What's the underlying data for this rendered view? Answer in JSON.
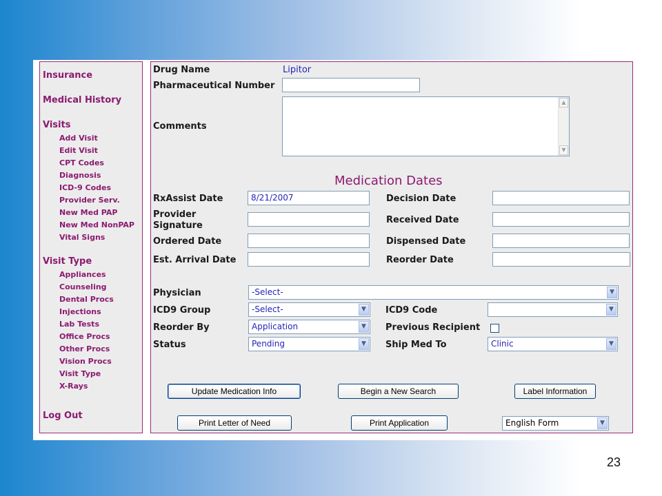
{
  "sidebar": {
    "insurance": "Insurance",
    "medical_history": "Medical History",
    "visits": "Visits",
    "visit_items": [
      "Add Visit",
      "Edit Visit",
      "CPT Codes",
      "Diagnosis",
      "ICD-9 Codes",
      "Provider Serv.",
      "New Med PAP",
      "New Med NonPAP",
      "Vital Signs"
    ],
    "visit_type": "Visit Type",
    "visit_type_items": [
      "Appliances",
      "Counseling",
      "Dental Procs",
      "Injections",
      "Lab Tests",
      "Office Procs",
      "Other Procs",
      "Vision Procs",
      "Visit Type",
      "X-Rays"
    ],
    "logout": "Log Out"
  },
  "form": {
    "drug_name_label": "Drug Name",
    "drug_name_value": "Lipitor",
    "pharma_number_label": "Pharmaceutical Number",
    "pharma_number_value": "",
    "comments_label": "Comments",
    "section_title": "Medication Dates",
    "rxassist_date_label": "RxAssist Date",
    "rxassist_date_value": "8/21/2007",
    "decision_date_label": "Decision Date",
    "provider_signature_label": "Provider Signature",
    "received_date_label": "Received Date",
    "ordered_date_label": "Ordered Date",
    "dispensed_date_label": "Dispensed Date",
    "est_arrival_label": "Est. Arrival Date",
    "reorder_date_label": "Reorder Date",
    "physician_label": "Physician",
    "physician_value": "-Select-",
    "icd9_group_label": "ICD9 Group",
    "icd9_group_value": "-Select-",
    "icd9_code_label": "ICD9 Code",
    "icd9_code_value": "",
    "reorder_by_label": "Reorder By",
    "reorder_by_value": "Application",
    "previous_recipient_label": "Previous Recipient",
    "status_label": "Status",
    "status_value": "Pending",
    "ship_med_to_label": "Ship Med To",
    "ship_med_to_value": "Clinic"
  },
  "buttons": {
    "update": "Update Medication Info",
    "new_search": "Begin a New Search",
    "label_info": "Label Information",
    "print_letter": "Print Letter of Need",
    "print_application": "Print Application",
    "form_language": "English Form"
  },
  "slide_number": "23",
  "icons": {
    "dropdown": "chevron-down-icon",
    "scroll_up": "scroll-up-icon",
    "scroll_down": "scroll-down-icon"
  }
}
